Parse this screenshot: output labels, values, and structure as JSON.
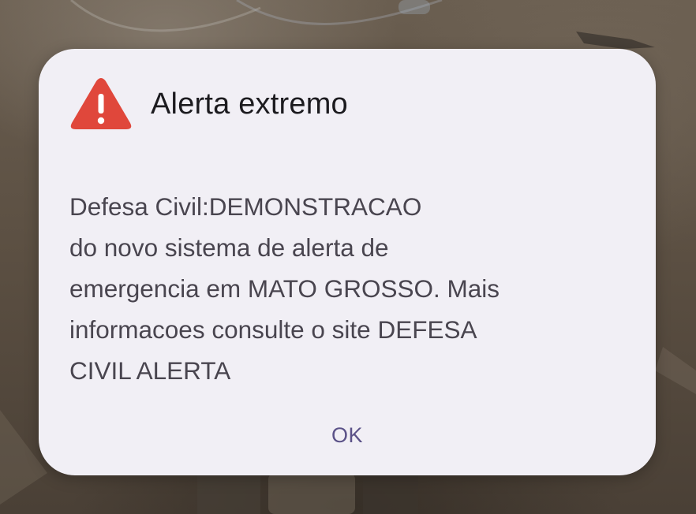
{
  "alert": {
    "title": "Alerta extremo",
    "icon": "warning-triangle-icon",
    "icon_color": "#e0473b",
    "message_lines": [
      "Defesa Civil:DEMONSTRACAO",
      "do novo sistema de alerta de",
      "emergencia em MATO GROSSO. Mais",
      "informacoes consulte o site DEFESA",
      "CIVIL ALERTA"
    ],
    "ok_label": "OK",
    "ok_color": "#5b5288"
  }
}
